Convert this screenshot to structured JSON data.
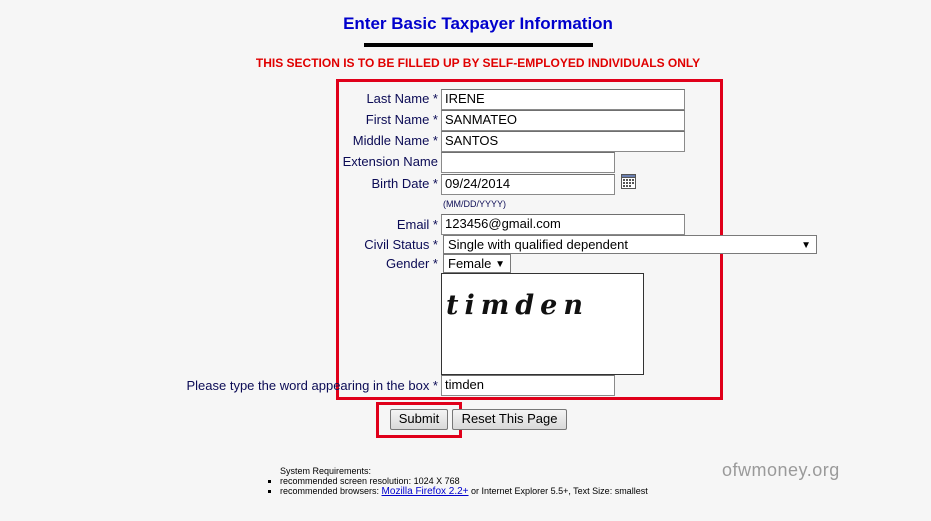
{
  "page": {
    "title": "Enter Basic Taxpayer Information",
    "notice": "THIS SECTION IS TO BE FILLED UP BY SELF-EMPLOYED INDIVIDUALS ONLY"
  },
  "form": {
    "last_name": {
      "label": "Last Name *",
      "value": "IRENE"
    },
    "first_name": {
      "label": "First Name *",
      "value": "SANMATEO"
    },
    "middle_name": {
      "label": "Middle Name *",
      "value": "SANTOS"
    },
    "extension_name": {
      "label": "Extension Name",
      "value": ""
    },
    "birth_date": {
      "label": "Birth Date *",
      "value": "09/24/2014",
      "format_hint": "(MM/DD/YYYY)",
      "icon": "calendar-icon"
    },
    "email": {
      "label": "Email  *",
      "value": "123456@gmail.com"
    },
    "civil_status": {
      "label": "Civil Status *",
      "selected": "Single with qualified dependent"
    },
    "gender": {
      "label": "Gender *",
      "selected": "Female"
    },
    "captcha": {
      "word": "timden",
      "prompt_label": "Please type the word appearing in the box *",
      "value": "timden"
    }
  },
  "buttons": {
    "submit": "Submit",
    "reset": "Reset This Page"
  },
  "requirements": {
    "heading": "System Requirements:",
    "resolution": "recommended screen resolution: 1024 X 768",
    "browsers_prefix": "recommended browsers: ",
    "browsers_link": "Mozilla Firefox 2.2+",
    "browsers_suffix": " or Internet Explorer 5.5+, Text Size: smallest"
  },
  "watermark": "ofwmoney.org",
  "colors": {
    "title": "#0000cc",
    "notice": "#e00000",
    "highlight": "#e0001a"
  }
}
